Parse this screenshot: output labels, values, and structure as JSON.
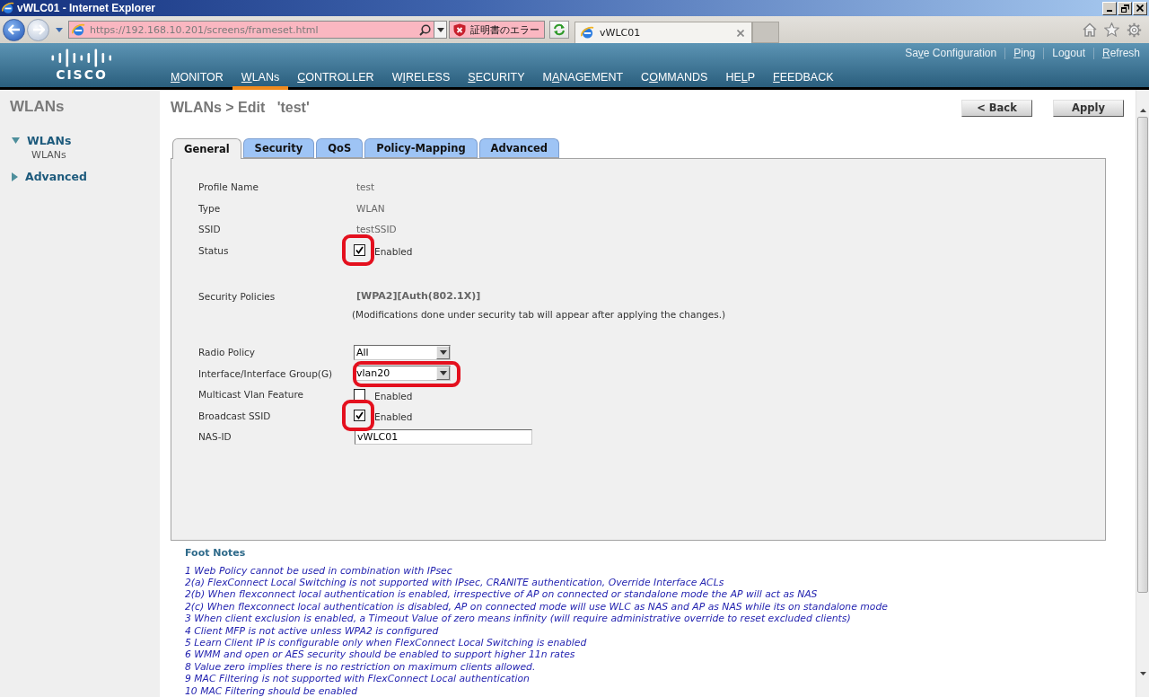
{
  "browser": {
    "window_title": "vWLC01 - Internet Explorer",
    "nav_buttons": [
      {
        "kind": "back",
        "disabled": false
      },
      {
        "kind": "forward",
        "disabled": true
      }
    ],
    "address": "https://192.168.10.201/screens/frameset.html",
    "certificate_error": "証明書のエラー",
    "tabs": [
      {
        "label": "vWLC01",
        "selected": true
      }
    ]
  },
  "header": {
    "logo_text": "CISCO",
    "links": [
      {
        "segments": [
          {
            "text": "Sa",
            "underlined": false
          },
          {
            "text": "v",
            "underlined": true
          },
          {
            "text": "e Configuration",
            "underlined": false
          }
        ]
      },
      {
        "segments": [
          {
            "text": "P",
            "underlined": true
          },
          {
            "text": "ing",
            "underlined": false
          }
        ]
      },
      {
        "segments": [
          {
            "text": "Lo",
            "underlined": false
          },
          {
            "text": "g",
            "underlined": true
          },
          {
            "text": "out",
            "underlined": false
          }
        ]
      },
      {
        "segments": [
          {
            "text": "R",
            "underlined": true
          },
          {
            "text": "efresh",
            "underlined": false
          }
        ]
      }
    ],
    "menu": [
      {
        "segments": [
          {
            "text": "M",
            "underlined": true
          },
          {
            "text": "ONITOR",
            "underlined": false
          }
        ],
        "selected": false
      },
      {
        "segments": [
          {
            "text": "W",
            "underlined": true
          },
          {
            "text": "LANs",
            "underlined": false
          }
        ],
        "selected": true
      },
      {
        "segments": [
          {
            "text": "C",
            "underlined": true
          },
          {
            "text": "ONTROLLER",
            "underlined": false
          }
        ],
        "selected": false
      },
      {
        "segments": [
          {
            "text": "W",
            "underlined": false
          },
          {
            "text": "I",
            "underlined": true
          },
          {
            "text": "RELESS",
            "underlined": false
          }
        ],
        "selected": false
      },
      {
        "segments": [
          {
            "text": "S",
            "underlined": true
          },
          {
            "text": "ECURITY",
            "underlined": false
          }
        ],
        "selected": false
      },
      {
        "segments": [
          {
            "text": "M",
            "underlined": false
          },
          {
            "text": "A",
            "underlined": true
          },
          {
            "text": "NAGEMENT",
            "underlined": false
          }
        ],
        "selected": false
      },
      {
        "segments": [
          {
            "text": "C",
            "underlined": false
          },
          {
            "text": "O",
            "underlined": true
          },
          {
            "text": "MMANDS",
            "underlined": false
          }
        ],
        "selected": false
      },
      {
        "segments": [
          {
            "text": "HE",
            "underlined": false
          },
          {
            "text": "L",
            "underlined": true
          },
          {
            "text": "P",
            "underlined": false
          }
        ],
        "selected": false
      },
      {
        "segments": [
          {
            "text": "F",
            "underlined": true
          },
          {
            "text": "EEDBACK",
            "underlined": false
          }
        ],
        "selected": false
      }
    ]
  },
  "sidebar": {
    "title": "WLANs",
    "tree": [
      {
        "label": "WLANs",
        "expanded": true,
        "children": [
          {
            "label": "WLANs"
          }
        ]
      },
      {
        "label": "Advanced",
        "expanded": false
      }
    ]
  },
  "page": {
    "title": "WLANs > Edit   'test'",
    "buttons": [
      "< Back",
      "Apply"
    ],
    "tabs": [
      {
        "label": "General",
        "selected": true
      },
      {
        "label": "Security",
        "selected": false
      },
      {
        "label": "QoS",
        "selected": false
      },
      {
        "label": "Policy-Mapping",
        "selected": false
      },
      {
        "label": "Advanced",
        "selected": false
      }
    ],
    "rows": [
      {
        "kind": "text",
        "label": "Profile Name",
        "value": "test"
      },
      {
        "kind": "text",
        "label": "Type",
        "value": "WLAN"
      },
      {
        "kind": "text",
        "label": "SSID",
        "value": "testSSID"
      },
      {
        "kind": "checkbox",
        "label": "Status",
        "checked": true,
        "text": "Enabled",
        "annotated": true
      },
      {
        "kind": "policy",
        "label": "Security Policies",
        "value": "[WPA2][Auth(802.1X)]",
        "note": "(Modifications done under security tab will appear after applying the changes.)"
      },
      {
        "kind": "select",
        "label": "Radio Policy",
        "value": "All",
        "annotated": false
      },
      {
        "kind": "select",
        "label": "Interface/Interface Group(G)",
        "value": "vlan20",
        "annotated": true
      },
      {
        "kind": "checkbox",
        "label": "Multicast Vlan Feature",
        "checked": false,
        "text": "Enabled",
        "annotated": false
      },
      {
        "kind": "checkbox",
        "label": "Broadcast SSID",
        "checked": true,
        "text": "Enabled",
        "annotated": true
      },
      {
        "kind": "input",
        "label": "NAS-ID",
        "value": "vWLC01"
      }
    ]
  },
  "footnotes": {
    "title": "Foot Notes",
    "lines": [
      "1 Web Policy cannot be used in combination with IPsec",
      "2(a) FlexConnect Local Switching is not supported with IPsec, CRANITE authentication, Override Interface ACLs",
      "2(b) When flexconnect local authentication is enabled, irrespective of AP on connected or standalone mode the AP will act as NAS",
      "2(c) When flexconnect local authentication is disabled, AP on connected mode will use WLC as NAS and AP as NAS while its on standalone mode",
      "3 When client exclusion is enabled, a Timeout Value of zero means infinity (will require administrative override to reset excluded clients)",
      "4 Client MFP is not active unless WPA2 is configured",
      "5 Learn Client IP is configurable only when FlexConnect Local Switching is enabled",
      "6 WMM and open or AES security should be enabled to support higher 11n rates",
      "8 Value zero implies there is no restriction on maximum clients allowed.",
      "9 MAC Filtering is not supported with FlexConnect Local authentication",
      "10 MAC Filtering should be enabled"
    ]
  }
}
